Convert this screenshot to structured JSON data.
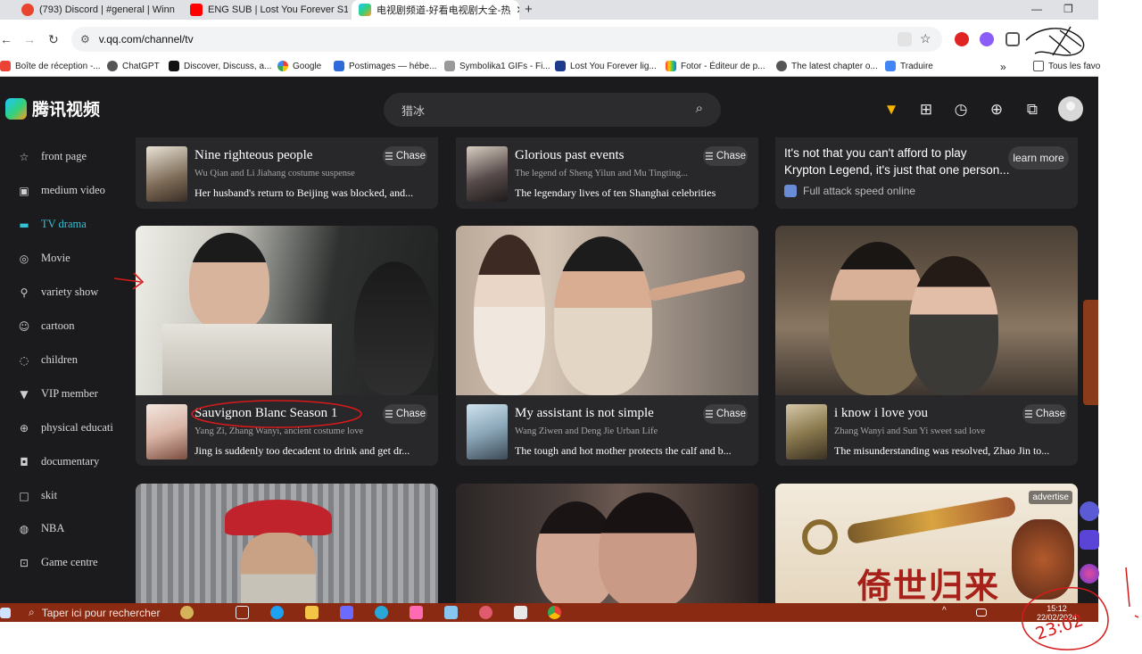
{
  "browser": {
    "tabs": [
      {
        "label": "(793) Discord | #general | Winn"
      },
      {
        "label": "ENG SUB | Lost You Forever S1"
      },
      {
        "label": "电视剧频道-好看电视剧大全-热"
      }
    ],
    "url": "v.qq.com/channel/tv",
    "bookmarks": [
      "Boîte de réception -...",
      "ChatGPT",
      "Discover, Discuss, a...",
      "Google",
      "Postimages — hébe...",
      "Symbolika1 GIFs - Fi...",
      "Lost You Forever lig...",
      "Fotor - Éditeur de p...",
      "The latest chapter o...",
      "Traduire"
    ],
    "bookmarks_more": "»",
    "all_bookmarks": "Tous les favo"
  },
  "site": {
    "logo_text": "腾讯视频",
    "search_placeholder": "猎冰",
    "nav": [
      {
        "label": "front page",
        "icon": "star-icon"
      },
      {
        "label": "medium video",
        "icon": "play-icon"
      },
      {
        "label": "TV drama",
        "icon": "tv-icon",
        "active": true
      },
      {
        "label": "Movie",
        "icon": "film-icon"
      },
      {
        "label": "variety show",
        "icon": "mic-icon"
      },
      {
        "label": "cartoon",
        "icon": "cartoon-icon"
      },
      {
        "label": "children",
        "icon": "children-icon"
      },
      {
        "label": "VIP member",
        "icon": "vip-icon"
      },
      {
        "label": "physical educati",
        "icon": "ball-icon"
      },
      {
        "label": "documentary",
        "icon": "camera-icon"
      },
      {
        "label": "skit",
        "icon": "skit-icon"
      },
      {
        "label": "NBA",
        "icon": "nba-icon"
      },
      {
        "label": "Game centre",
        "icon": "gamepad-icon"
      }
    ],
    "chase_label": "Chase",
    "top_cards": [
      {
        "title": "Nine righteous people",
        "sub": "Wu Qian and Li Jiahang costume suspense",
        "desc": "Her husband's return to Beijing was blocked, and..."
      },
      {
        "title": "Glorious past events",
        "sub": "The legend of Sheng Yilun and Mu Tingting...",
        "desc": "The legendary lives of ten Shanghai celebrities"
      }
    ],
    "ad_top": {
      "line1": "It's not that you can't afford to play",
      "line2": "Krypton Legend, it's just that one person...",
      "foot": "Full attack speed online",
      "button": "learn more"
    },
    "mid_cards": [
      {
        "title": "Sauvignon Blanc Season 1",
        "sub": "Yang Zi, Zhang Wanyi, ancient costume love",
        "desc": "Jing is suddenly too decadent to drink and get dr..."
      },
      {
        "title": "My assistant is not simple",
        "sub": "Wang Ziwen and Deng Jie Urban Life",
        "desc": "The tough and hot mother protects the calf and b..."
      },
      {
        "title": "i know i love you",
        "sub": "Zhang Wanyi and Sun Yi sweet sad love",
        "desc": "The misunderstanding was resolved, Zhao Jin to..."
      }
    ],
    "ad_bottom": {
      "badge": "advertise",
      "title": "倚世归来"
    }
  },
  "taskbar": {
    "search_placeholder": "Taper ici pour rechercher",
    "time": "15:12",
    "date": "22/02/2024"
  },
  "annotations": {
    "handwritten_time": "23:02"
  },
  "colors": {
    "accent": "#33c3d6",
    "site_bg": "#1b1b1d",
    "card_bg": "#28282b",
    "taskbar": "#8b2a12",
    "ink": "#d61a1a"
  }
}
